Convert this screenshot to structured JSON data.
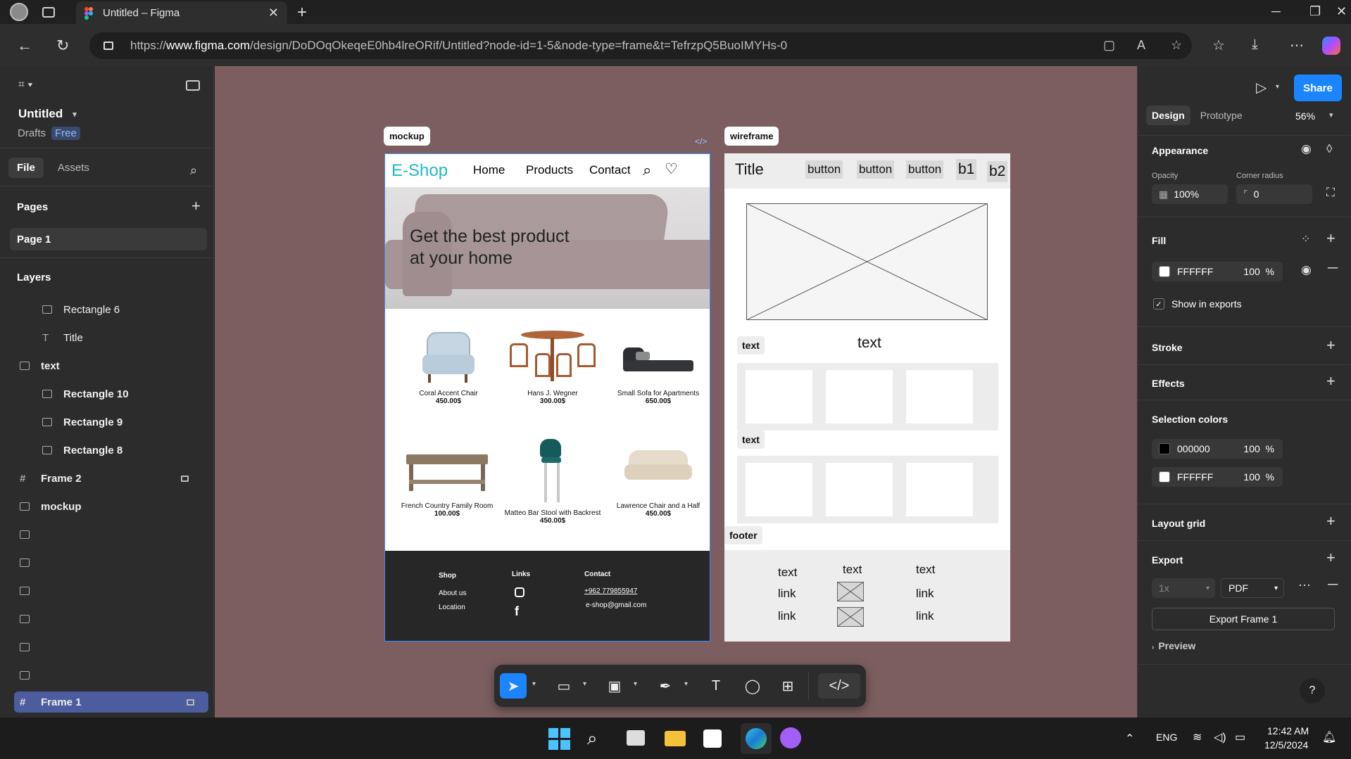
{
  "browser": {
    "tab_title": "Untitled – Figma",
    "url_prefix": "https://",
    "url_host": "www.figma.com",
    "url_path": "/design/DoDOqOkeqeE0hb4lreORif/Untitled?node-id=1-5&node-type=frame&t=TefrzpQ5BuoIMYHs-0"
  },
  "left_panel": {
    "file_name": "Untitled",
    "drafts": "Drafts",
    "plan_badge": "Free",
    "tabs": [
      "File",
      "Assets"
    ],
    "pages_title": "Pages",
    "page_item": "Page 1",
    "layers_title": "Layers",
    "layers": [
      {
        "name": "Rectangle 6",
        "indent": true,
        "icon": "rectangle-icon"
      },
      {
        "name": "Title",
        "indent": true,
        "icon": "text-icon"
      },
      {
        "name": "text",
        "indent": false,
        "icon": "frame-icon"
      },
      {
        "name": "Rectangle 10",
        "indent": true,
        "icon": "rectangle-icon"
      },
      {
        "name": "Rectangle 9",
        "indent": true,
        "icon": "rectangle-icon"
      },
      {
        "name": "Rectangle 8",
        "indent": true,
        "icon": "rectangle-icon"
      },
      {
        "name": "Frame 2",
        "indent": false,
        "icon": "hash-icon",
        "locked": true
      },
      {
        "name": "mockup",
        "indent": false,
        "icon": "frame-icon"
      }
    ],
    "selected_layer": "Frame 1"
  },
  "canvas": {
    "mockup_label": "mockup",
    "wireframe_label": "wireframe",
    "mockup": {
      "brand": "E-Shop",
      "nav": [
        "Home",
        "Products",
        "Contact"
      ],
      "hero_line1": "Get the best product",
      "hero_line2": "at your home",
      "products": [
        {
          "name": "Coral Accent Chair",
          "price": "450.00$"
        },
        {
          "name": "Hans J. Wegner",
          "price": "300.00$"
        },
        {
          "name": "Small Sofa for Apartments",
          "price": "650.00$"
        },
        {
          "name": "French Country Family Room",
          "price": "100.00$"
        },
        {
          "name": "Matteo Bar Stool with Backrest",
          "price": "450.00$"
        },
        {
          "name": "Lawrence Chair and a Half",
          "price": "450.00$"
        }
      ],
      "footer": {
        "shop": "Shop",
        "about": "About us",
        "location": "Location",
        "links": "Links",
        "contact": "Contact",
        "phone": "+962 779855947",
        "email": "e-shop@gmail.com"
      }
    },
    "wireframe": {
      "title": "Title",
      "buttons": [
        "button",
        "button",
        "button",
        "b1",
        "b2"
      ],
      "text_center": "text",
      "chip_text1": "text",
      "chip_text2": "text",
      "chip_footer": "footer",
      "footer_cols": [
        {
          "head": "text",
          "r1": "link",
          "r2": "link"
        },
        {
          "head": "text"
        },
        {
          "head": "text",
          "r1": "link",
          "r2": "link"
        }
      ]
    }
  },
  "right_panel": {
    "share": "Share",
    "tab_design": "Design",
    "tab_prototype": "Prototype",
    "zoom": "56%",
    "appearance": "Appearance",
    "opacity_label": "Opacity",
    "opacity_value": "100%",
    "radius_label": "Corner radius",
    "radius_value": "0",
    "fill": "Fill",
    "fill_hex": "FFFFFF",
    "fill_pct": "100",
    "pct": "%",
    "show_exports": "Show in exports",
    "stroke": "Stroke",
    "effects": "Effects",
    "selection_colors": "Selection colors",
    "sel1_hex": "000000",
    "sel1_pct": "100",
    "sel2_hex": "FFFFFF",
    "sel2_pct": "100",
    "layout_grid": "Layout grid",
    "export": "Export",
    "export_scale": "1x",
    "export_format": "PDF",
    "export_button": "Export Frame 1",
    "preview": "Preview",
    "help": "?"
  },
  "taskbar": {
    "lang": "ENG",
    "time": "12:42 AM",
    "date": "12/5/2024"
  },
  "colors": {
    "canvas": "#7c5e60",
    "accent": "#1a85ff",
    "brand": "#21b8c9"
  }
}
